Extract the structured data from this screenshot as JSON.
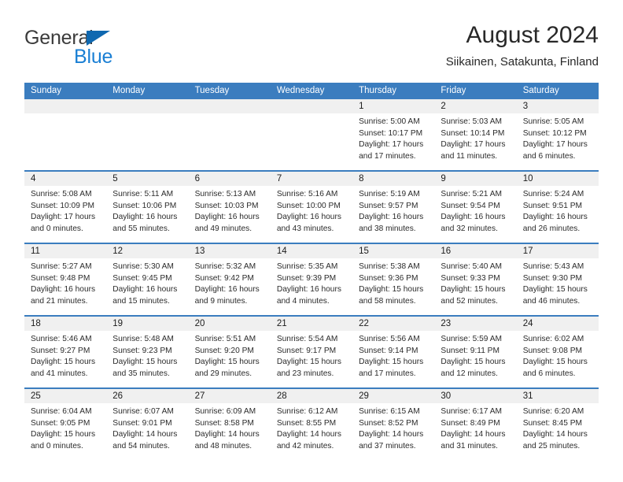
{
  "logo": {
    "word_one": "General",
    "word_two": "Blue",
    "triangle_color": "#0f68b0",
    "blue_color": "#1a7fd4"
  },
  "header": {
    "title": "August 2024",
    "subtitle": "Siikainen, Satakunta, Finland"
  },
  "theme": {
    "header_blue": "#3b7dbf",
    "daynum_band": "#f0f0f0",
    "text": "#2b2b2b"
  },
  "weekdays": [
    "Sunday",
    "Monday",
    "Tuesday",
    "Wednesday",
    "Thursday",
    "Friday",
    "Saturday"
  ],
  "weeks": [
    {
      "days": [
        {
          "num": "",
          "sunrise": "",
          "sunset": "",
          "daylight_line1": "",
          "daylight_line2": "",
          "empty": true
        },
        {
          "num": "",
          "sunrise": "",
          "sunset": "",
          "daylight_line1": "",
          "daylight_line2": "",
          "empty": true
        },
        {
          "num": "",
          "sunrise": "",
          "sunset": "",
          "daylight_line1": "",
          "daylight_line2": "",
          "empty": true
        },
        {
          "num": "",
          "sunrise": "",
          "sunset": "",
          "daylight_line1": "",
          "daylight_line2": "",
          "empty": true
        },
        {
          "num": "1",
          "sunrise": "Sunrise: 5:00 AM",
          "sunset": "Sunset: 10:17 PM",
          "daylight_line1": "Daylight: 17 hours",
          "daylight_line2": "and 17 minutes.",
          "empty": false
        },
        {
          "num": "2",
          "sunrise": "Sunrise: 5:03 AM",
          "sunset": "Sunset: 10:14 PM",
          "daylight_line1": "Daylight: 17 hours",
          "daylight_line2": "and 11 minutes.",
          "empty": false
        },
        {
          "num": "3",
          "sunrise": "Sunrise: 5:05 AM",
          "sunset": "Sunset: 10:12 PM",
          "daylight_line1": "Daylight: 17 hours",
          "daylight_line2": "and 6 minutes.",
          "empty": false
        }
      ]
    },
    {
      "days": [
        {
          "num": "4",
          "sunrise": "Sunrise: 5:08 AM",
          "sunset": "Sunset: 10:09 PM",
          "daylight_line1": "Daylight: 17 hours",
          "daylight_line2": "and 0 minutes.",
          "empty": false
        },
        {
          "num": "5",
          "sunrise": "Sunrise: 5:11 AM",
          "sunset": "Sunset: 10:06 PM",
          "daylight_line1": "Daylight: 16 hours",
          "daylight_line2": "and 55 minutes.",
          "empty": false
        },
        {
          "num": "6",
          "sunrise": "Sunrise: 5:13 AM",
          "sunset": "Sunset: 10:03 PM",
          "daylight_line1": "Daylight: 16 hours",
          "daylight_line2": "and 49 minutes.",
          "empty": false
        },
        {
          "num": "7",
          "sunrise": "Sunrise: 5:16 AM",
          "sunset": "Sunset: 10:00 PM",
          "daylight_line1": "Daylight: 16 hours",
          "daylight_line2": "and 43 minutes.",
          "empty": false
        },
        {
          "num": "8",
          "sunrise": "Sunrise: 5:19 AM",
          "sunset": "Sunset: 9:57 PM",
          "daylight_line1": "Daylight: 16 hours",
          "daylight_line2": "and 38 minutes.",
          "empty": false
        },
        {
          "num": "9",
          "sunrise": "Sunrise: 5:21 AM",
          "sunset": "Sunset: 9:54 PM",
          "daylight_line1": "Daylight: 16 hours",
          "daylight_line2": "and 32 minutes.",
          "empty": false
        },
        {
          "num": "10",
          "sunrise": "Sunrise: 5:24 AM",
          "sunset": "Sunset: 9:51 PM",
          "daylight_line1": "Daylight: 16 hours",
          "daylight_line2": "and 26 minutes.",
          "empty": false
        }
      ]
    },
    {
      "days": [
        {
          "num": "11",
          "sunrise": "Sunrise: 5:27 AM",
          "sunset": "Sunset: 9:48 PM",
          "daylight_line1": "Daylight: 16 hours",
          "daylight_line2": "and 21 minutes.",
          "empty": false
        },
        {
          "num": "12",
          "sunrise": "Sunrise: 5:30 AM",
          "sunset": "Sunset: 9:45 PM",
          "daylight_line1": "Daylight: 16 hours",
          "daylight_line2": "and 15 minutes.",
          "empty": false
        },
        {
          "num": "13",
          "sunrise": "Sunrise: 5:32 AM",
          "sunset": "Sunset: 9:42 PM",
          "daylight_line1": "Daylight: 16 hours",
          "daylight_line2": "and 9 minutes.",
          "empty": false
        },
        {
          "num": "14",
          "sunrise": "Sunrise: 5:35 AM",
          "sunset": "Sunset: 9:39 PM",
          "daylight_line1": "Daylight: 16 hours",
          "daylight_line2": "and 4 minutes.",
          "empty": false
        },
        {
          "num": "15",
          "sunrise": "Sunrise: 5:38 AM",
          "sunset": "Sunset: 9:36 PM",
          "daylight_line1": "Daylight: 15 hours",
          "daylight_line2": "and 58 minutes.",
          "empty": false
        },
        {
          "num": "16",
          "sunrise": "Sunrise: 5:40 AM",
          "sunset": "Sunset: 9:33 PM",
          "daylight_line1": "Daylight: 15 hours",
          "daylight_line2": "and 52 minutes.",
          "empty": false
        },
        {
          "num": "17",
          "sunrise": "Sunrise: 5:43 AM",
          "sunset": "Sunset: 9:30 PM",
          "daylight_line1": "Daylight: 15 hours",
          "daylight_line2": "and 46 minutes.",
          "empty": false
        }
      ]
    },
    {
      "days": [
        {
          "num": "18",
          "sunrise": "Sunrise: 5:46 AM",
          "sunset": "Sunset: 9:27 PM",
          "daylight_line1": "Daylight: 15 hours",
          "daylight_line2": "and 41 minutes.",
          "empty": false
        },
        {
          "num": "19",
          "sunrise": "Sunrise: 5:48 AM",
          "sunset": "Sunset: 9:23 PM",
          "daylight_line1": "Daylight: 15 hours",
          "daylight_line2": "and 35 minutes.",
          "empty": false
        },
        {
          "num": "20",
          "sunrise": "Sunrise: 5:51 AM",
          "sunset": "Sunset: 9:20 PM",
          "daylight_line1": "Daylight: 15 hours",
          "daylight_line2": "and 29 minutes.",
          "empty": false
        },
        {
          "num": "21",
          "sunrise": "Sunrise: 5:54 AM",
          "sunset": "Sunset: 9:17 PM",
          "daylight_line1": "Daylight: 15 hours",
          "daylight_line2": "and 23 minutes.",
          "empty": false
        },
        {
          "num": "22",
          "sunrise": "Sunrise: 5:56 AM",
          "sunset": "Sunset: 9:14 PM",
          "daylight_line1": "Daylight: 15 hours",
          "daylight_line2": "and 17 minutes.",
          "empty": false
        },
        {
          "num": "23",
          "sunrise": "Sunrise: 5:59 AM",
          "sunset": "Sunset: 9:11 PM",
          "daylight_line1": "Daylight: 15 hours",
          "daylight_line2": "and 12 minutes.",
          "empty": false
        },
        {
          "num": "24",
          "sunrise": "Sunrise: 6:02 AM",
          "sunset": "Sunset: 9:08 PM",
          "daylight_line1": "Daylight: 15 hours",
          "daylight_line2": "and 6 minutes.",
          "empty": false
        }
      ]
    },
    {
      "days": [
        {
          "num": "25",
          "sunrise": "Sunrise: 6:04 AM",
          "sunset": "Sunset: 9:05 PM",
          "daylight_line1": "Daylight: 15 hours",
          "daylight_line2": "and 0 minutes.",
          "empty": false
        },
        {
          "num": "26",
          "sunrise": "Sunrise: 6:07 AM",
          "sunset": "Sunset: 9:01 PM",
          "daylight_line1": "Daylight: 14 hours",
          "daylight_line2": "and 54 minutes.",
          "empty": false
        },
        {
          "num": "27",
          "sunrise": "Sunrise: 6:09 AM",
          "sunset": "Sunset: 8:58 PM",
          "daylight_line1": "Daylight: 14 hours",
          "daylight_line2": "and 48 minutes.",
          "empty": false
        },
        {
          "num": "28",
          "sunrise": "Sunrise: 6:12 AM",
          "sunset": "Sunset: 8:55 PM",
          "daylight_line1": "Daylight: 14 hours",
          "daylight_line2": "and 42 minutes.",
          "empty": false
        },
        {
          "num": "29",
          "sunrise": "Sunrise: 6:15 AM",
          "sunset": "Sunset: 8:52 PM",
          "daylight_line1": "Daylight: 14 hours",
          "daylight_line2": "and 37 minutes.",
          "empty": false
        },
        {
          "num": "30",
          "sunrise": "Sunrise: 6:17 AM",
          "sunset": "Sunset: 8:49 PM",
          "daylight_line1": "Daylight: 14 hours",
          "daylight_line2": "and 31 minutes.",
          "empty": false
        },
        {
          "num": "31",
          "sunrise": "Sunrise: 6:20 AM",
          "sunset": "Sunset: 8:45 PM",
          "daylight_line1": "Daylight: 14 hours",
          "daylight_line2": "and 25 minutes.",
          "empty": false
        }
      ]
    }
  ]
}
